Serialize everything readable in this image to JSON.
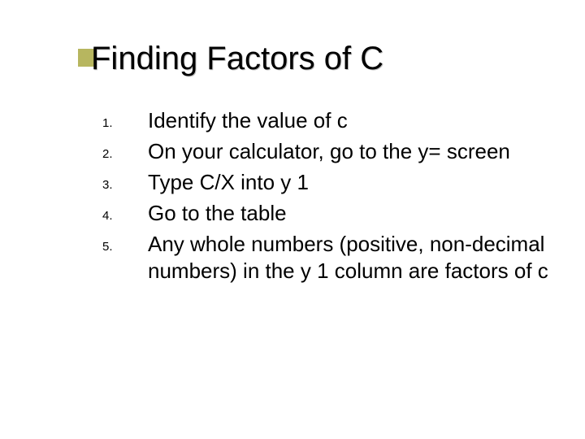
{
  "title": "Finding Factors of C",
  "items": [
    {
      "n": "1.",
      "t": "Identify the value of c"
    },
    {
      "n": "2.",
      "t": "On your calculator, go to the y= screen"
    },
    {
      "n": "3.",
      "t": "Type C/X into y 1"
    },
    {
      "n": "4.",
      "t": "Go to the table"
    },
    {
      "n": "5.",
      "t": "Any whole numbers (positive, non-decimal numbers) in the y 1 column are factors of c"
    }
  ]
}
